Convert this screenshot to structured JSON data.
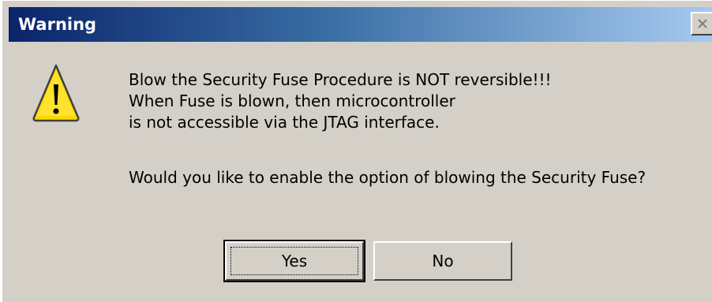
{
  "window": {
    "title": "Warning",
    "close_icon": "close-icon"
  },
  "dialog": {
    "icon": "warning-icon",
    "message_lines": [
      "Blow the Security Fuse Procedure is NOT reversible!!!",
      "When Fuse is blown, then microcontroller",
      "is not accessible via the JTAG interface."
    ],
    "question": "Would you like to enable the option of blowing the Security Fuse?"
  },
  "buttons": {
    "yes_label": "Yes",
    "no_label": "No"
  },
  "colors": {
    "face": "#d4d0c8",
    "title_start": "#0a246a",
    "title_end": "#a6caf0",
    "warning_fill": "#ffd700"
  }
}
